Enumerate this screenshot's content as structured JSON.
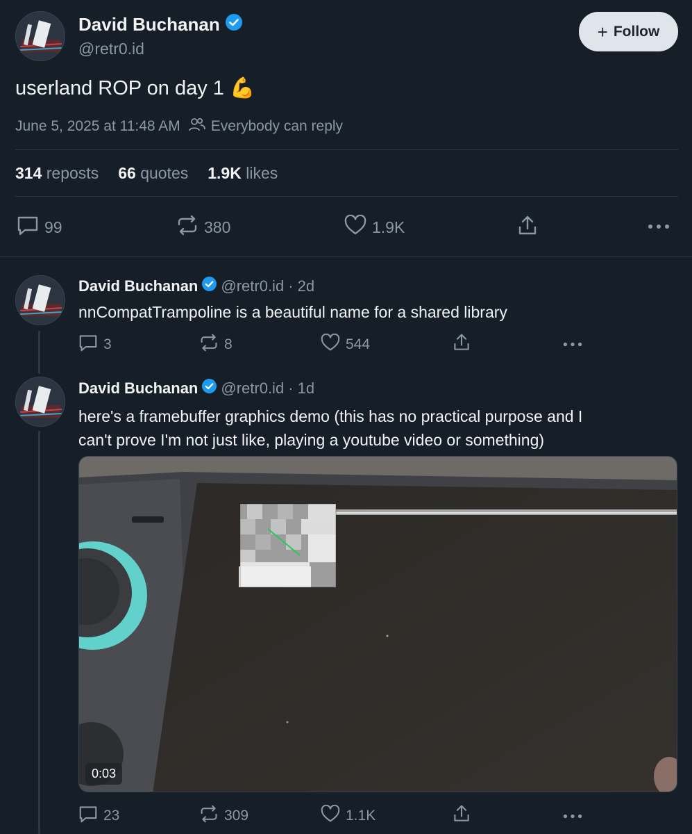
{
  "main_post": {
    "author_name": "David Buchanan",
    "handle": "@retr0.id",
    "follow_label": "Follow",
    "text": "userland ROP on day 1 💪",
    "timestamp": "June 5, 2025 at 11:48 AM",
    "reply_setting": "Everybody can reply",
    "stats": {
      "reposts_count": "314",
      "reposts_label": "reposts",
      "quotes_count": "66",
      "quotes_label": "quotes",
      "likes_count": "1.9K",
      "likes_label": "likes"
    },
    "actions": {
      "replies": "99",
      "reposts": "380",
      "likes": "1.9K"
    }
  },
  "replies": [
    {
      "author_name": "David Buchanan",
      "handle": "@retr0.id",
      "time": "· 2d",
      "text": "nnCompatTrampoline is a beautiful name for a shared library",
      "actions": {
        "replies": "3",
        "reposts": "8",
        "likes": "544"
      }
    },
    {
      "author_name": "David Buchanan",
      "handle": "@retr0.id",
      "time": "· 1d",
      "text_line1": "here's a framebuffer graphics demo (this has no practical purpose and I",
      "text_line2": "can't prove I'm not just like, playing a youtube video or something)",
      "video_duration": "0:03",
      "actions": {
        "replies": "23",
        "reposts": "309",
        "likes": "1.1K"
      }
    }
  ],
  "colors": {
    "background": "#161e27",
    "accent": "#1d9bf0",
    "muted_text": "#8b98a5",
    "follow_button_bg": "#dfe5eb"
  }
}
